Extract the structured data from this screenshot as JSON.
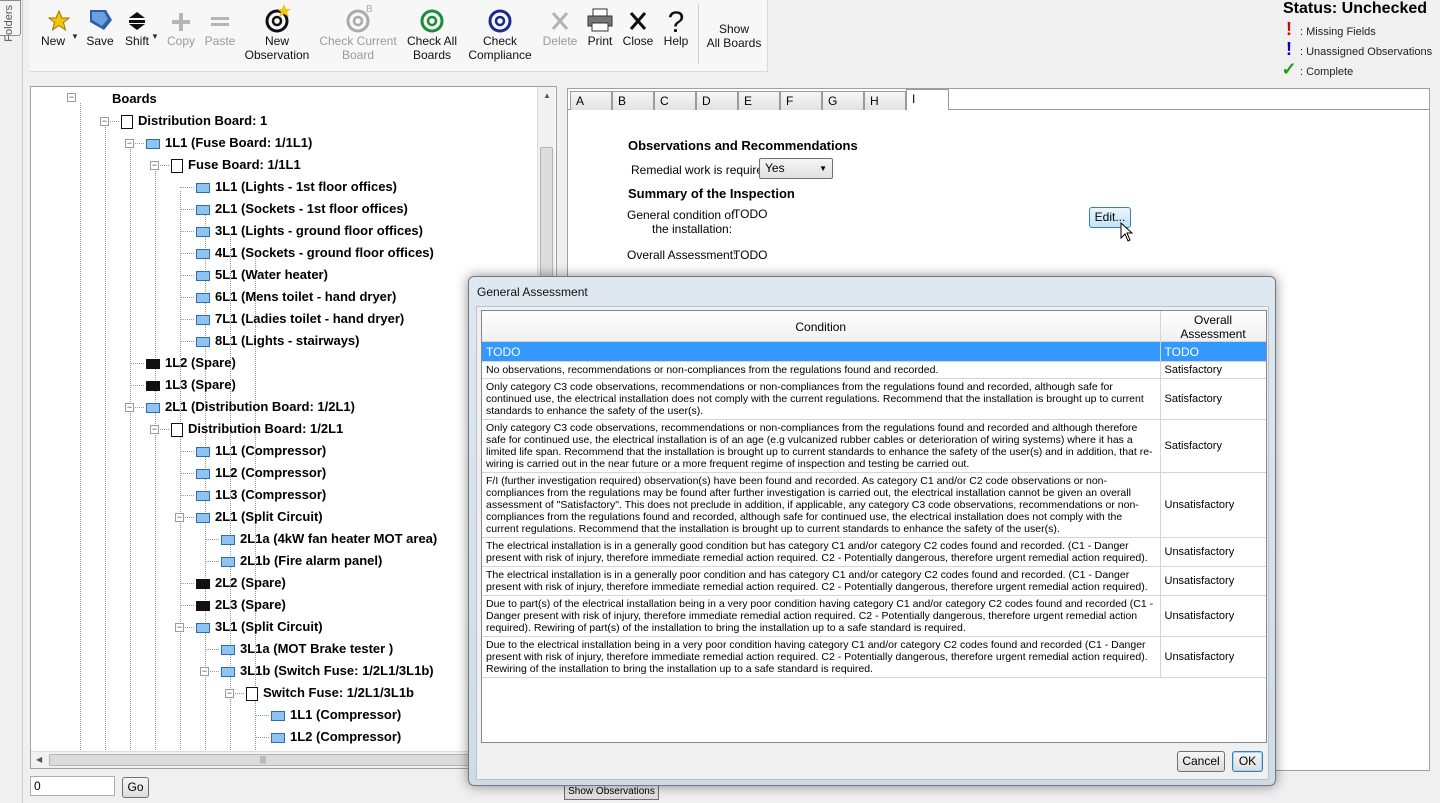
{
  "side_tab": {
    "label": "Folders"
  },
  "toolbar": {
    "new": "New",
    "save": "Save",
    "shift": "Shift",
    "copy": "Copy",
    "paste": "Paste",
    "new_observation_1": "New",
    "new_observation_2": "Observation",
    "check_current_1": "Check Current",
    "check_current_2": "Board",
    "check_all_1": "Check All",
    "check_all_2": "Boards",
    "check_compliance_1": "Check",
    "check_compliance_2": "Compliance",
    "delete": "Delete",
    "print": "Print",
    "close": "Close",
    "help": "Help",
    "show_all_1": "Show",
    "show_all_2": "All Boards"
  },
  "status": {
    "title": "Status: Unchecked",
    "legend": [
      {
        "mark": "!",
        "color": "#e00000",
        "text": ": Missing Fields"
      },
      {
        "mark": "!",
        "color": "#0000cc",
        "text": ": Unassigned Observations"
      },
      {
        "mark": "✓",
        "color": "#1f9a1f",
        "text": ": Complete"
      }
    ]
  },
  "tree": {
    "root": "Boards",
    "nodes": [
      {
        "label": "Distribution Board: 1",
        "icon": "board-icon",
        "level": 0
      },
      {
        "label": "1L1 (Fuse Board: 1/1L1)",
        "icon": "fuse-icon",
        "level": 1
      },
      {
        "label": "Fuse Board: 1/1L1",
        "icon": "board-icon",
        "level": 2
      },
      {
        "label": "1L1 (Lights - 1st floor offices)",
        "icon": "fuse-icon",
        "level": 3
      },
      {
        "label": "2L1 (Sockets - 1st floor offices)",
        "icon": "fuse-icon",
        "level": 3
      },
      {
        "label": "3L1 (Lights - ground floor offices)",
        "icon": "fuse-icon",
        "level": 3
      },
      {
        "label": "4L1 (Sockets - ground floor offices)",
        "icon": "fuse-icon",
        "level": 3
      },
      {
        "label": "5L1 (Water heater)",
        "icon": "fuse-icon",
        "level": 3
      },
      {
        "label": "6L1 (Mens toilet - hand dryer)",
        "icon": "fuse-icon",
        "level": 3
      },
      {
        "label": "7L1 (Ladies toilet - hand dryer)",
        "icon": "fuse-icon",
        "level": 3
      },
      {
        "label": "8L1 (Lights - stairways)",
        "icon": "fuse-icon",
        "level": 3
      },
      {
        "label": "1L2 (Spare)",
        "icon": "spare-icon",
        "level": 1
      },
      {
        "label": "1L3 (Spare)",
        "icon": "spare-icon",
        "level": 1
      },
      {
        "label": "2L1 (Distribution Board: 1/2L1)",
        "icon": "fuse-icon",
        "level": 1
      },
      {
        "label": "Distribution Board: 1/2L1",
        "icon": "board-icon",
        "level": 2
      },
      {
        "label": "1L1 (Compressor)",
        "icon": "fuse-icon",
        "level": 3
      },
      {
        "label": "1L2 (Compressor)",
        "icon": "fuse-icon",
        "level": 3
      },
      {
        "label": "1L3 (Compressor)",
        "icon": "fuse-icon",
        "level": 3
      },
      {
        "label": "2L1 (Split Circuit)",
        "icon": "split-icon",
        "level": 3
      },
      {
        "label": "2L1a (4kW fan heater MOT area)",
        "icon": "fuse-icon",
        "level": 4
      },
      {
        "label": "2L1b (Fire alarm panel)",
        "icon": "fuse-icon",
        "level": 4
      },
      {
        "label": "2L2 (Spare)",
        "icon": "spare-icon",
        "level": 3
      },
      {
        "label": "2L3 (Spare)",
        "icon": "spare-icon",
        "level": 3
      },
      {
        "label": "3L1 (Split Circuit)",
        "icon": "split-icon",
        "level": 3
      },
      {
        "label": "3L1a (MOT Brake tester )",
        "icon": "fuse-icon",
        "level": 4
      },
      {
        "label": "3L1b (Switch Fuse: 1/2L1/3L1b)",
        "icon": "fuse-icon",
        "level": 4
      },
      {
        "label": "Switch Fuse: 1/2L1/3L1b",
        "icon": "board-icon",
        "level": 5
      },
      {
        "label": "1L1 (Compressor)",
        "icon": "fuse-icon",
        "level": 6
      },
      {
        "label": "1L2 (Compressor)",
        "icon": "fuse-icon",
        "level": 6
      }
    ]
  },
  "goto": {
    "value": "0",
    "button": "Go"
  },
  "tabs": [
    "A",
    "B",
    "C",
    "D",
    "E",
    "F",
    "G",
    "H",
    "I"
  ],
  "sheet": {
    "obs_heading": "Observations and Recommendations",
    "remedial_label": "Remedial work is required:",
    "remedial_value": "Yes",
    "summary_heading": "Summary of the Inspection",
    "general_label_1": "General condition of",
    "general_label_2": "the installation:",
    "general_value": "TODO",
    "edit_button": "Edit...",
    "overall_label": "Overall Assessment:",
    "overall_value": "TODO"
  },
  "show_observations": "Show Observations",
  "dialog": {
    "title": "General Assessment",
    "col_condition": "Condition",
    "col_overall": "Overall Assessment",
    "rows": [
      {
        "condition": "TODO",
        "overall": "TODO",
        "selected": true
      },
      {
        "condition": "No observations, recommendations or non-compliances from the regulations found and recorded.",
        "overall": "Satisfactory"
      },
      {
        "condition": "Only category C3 code observations, recommendations or non-compliances from the regulations found and recorded, although safe for continued use, the electrical installation does not comply with the current regulations. Recommend that the installation is brought up to current standards to enhance the safety of the user(s).",
        "overall": "Satisfactory"
      },
      {
        "condition": "Only category C3 code observations, recommendations or non-compliances from the regulations found and recorded and although therefore safe for continued use, the electrical installation is of an age (e.g vulcanized rubber cables or deterioration of wiring systems) where it has a limited life span. Recommend that the installation is brought up to current standards to enhance the safety of the user(s) and in addition, that re-wiring is carried out in the near future or a more frequent regime of inspection and testing be carried out.",
        "overall": "Satisfactory"
      },
      {
        "condition": "F/I (further investigation required) observation(s) have been found and recorded. As category C1 and/or C2 code observations or non-compliances from the regulations may be found after further investigation is carried out, the electrical installation cannot be given an overall assessment of \"Satisfactory\". This does not preclude in addition, if applicable, any category C3 code observations, recommendations or non-compliances from the regulations found and recorded, although safe for continued use, the electrical installation does not comply with the current regulations. Recommend that the installation is brought up to current standards to enhance the safety of the user(s).",
        "overall": "Unsatisfactory"
      },
      {
        "condition": "The electrical installation is in a generally good condition but has category C1 and/or category C2 codes found and recorded. (C1 - Danger present with risk of injury, therefore immediate remedial action required. C2 - Potentially dangerous, therefore urgent remedial action required).",
        "overall": "Unsatisfactory"
      },
      {
        "condition": "The electrical installation is in a generally poor condition and has category C1 and/or category C2 codes found and recorded. (C1 - Danger present with risk of injury, therefore immediate remedial action required. C2 - Potentially dangerous, therefore urgent remedial action required).",
        "overall": "Unsatisfactory"
      },
      {
        "condition": "Due to part(s) of the electrical installation being in a very poor condition having category C1 and/or category C2 codes found and recorded (C1 - Danger present with risk of injury, therefore immediate remedial action required. C2 - Potentially dangerous, therefore urgent remedial action required). Rewiring of part(s) of the installation to bring the installation up to a safe standard is required.",
        "overall": "Unsatisfactory"
      },
      {
        "condition": "Due to the electrical installation being in a very poor condition having category C1 and/or category C2 codes found and recorded (C1 - Danger present with risk of injury, therefore immediate remedial action required. C2 - Potentially dangerous, therefore urgent remedial action required). Rewiring of the installation to bring the installation up to a safe standard is required.",
        "overall": "Unsatisfactory"
      }
    ],
    "cancel": "Cancel",
    "ok": "OK"
  }
}
